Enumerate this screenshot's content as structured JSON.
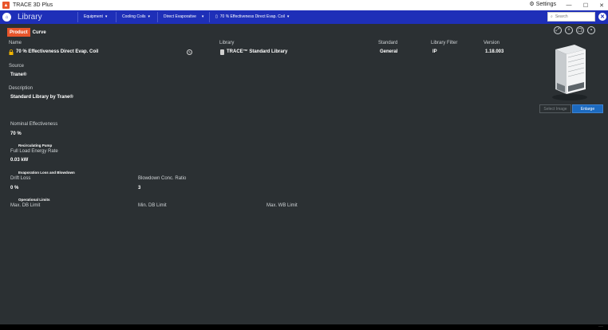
{
  "window": {
    "title": "TRACE 3D Plus",
    "settings_label": "Settings",
    "minimize": "—",
    "maximize": "☐",
    "close": "✕"
  },
  "nav": {
    "title": "Library",
    "breadcrumbs": [
      {
        "label": "Equipment"
      },
      {
        "label": "Cooling Coils"
      },
      {
        "label": "Direct Evaporative"
      },
      {
        "label": "70 % Effectiveness Direct Evap. Coil"
      }
    ],
    "search_placeholder": "Search"
  },
  "tabs": [
    {
      "label": "Product",
      "active": true
    },
    {
      "label": "Curve",
      "active": false
    }
  ],
  "header": {
    "name_label": "Name",
    "name_value": "70 % Effectiveness Direct Evap. Coil",
    "library_label": "Library",
    "library_value": "TRACE™ Standard Library",
    "standard_label": "Standard",
    "standard_value": "General",
    "filter_label": "Library Filter",
    "filter_value": "IP",
    "version_label": "Version",
    "version_value": "1.18.003"
  },
  "source": {
    "label": "Source",
    "value": "Trane®"
  },
  "description": {
    "label": "Description",
    "value": "Standard Library by Trane®"
  },
  "image_buttons": {
    "select": "Select Image",
    "enlarge": "Enlarge"
  },
  "performance": {
    "nominal_effectiveness_label": "Nominal Effectiveness",
    "nominal_effectiveness_value": "70 %",
    "pump_header": "Recirculating Pump",
    "full_load_label": "Full Load Energy Rate",
    "full_load_value": "0.03 kW",
    "evap_header": "Evaporation Loss and Blowdown",
    "drift_loss_label": "Drift Loss",
    "drift_loss_value": "0 %",
    "blowdown_label": "Blowdown Conc. Ratio",
    "blowdown_value": "3",
    "limits_header": "Operational Limits",
    "max_db_label": "Max. DB Limit",
    "min_db_label": "Min. DB Limit",
    "max_wb_label": "Max. WB Limit"
  },
  "colors": {
    "accent": "#e8552b",
    "nav_blue": "#1e2fb8",
    "background": "#2b3033",
    "button_blue": "#1c6ac0"
  },
  "icons": [
    "app-icon",
    "gear-icon",
    "logo-icon",
    "chevron-down-icon",
    "document-icon",
    "search-icon",
    "close-icon",
    "collapse-icon",
    "add-icon",
    "copy-icon",
    "delete-icon",
    "lock-icon",
    "edit-icon",
    "library-icon"
  ]
}
